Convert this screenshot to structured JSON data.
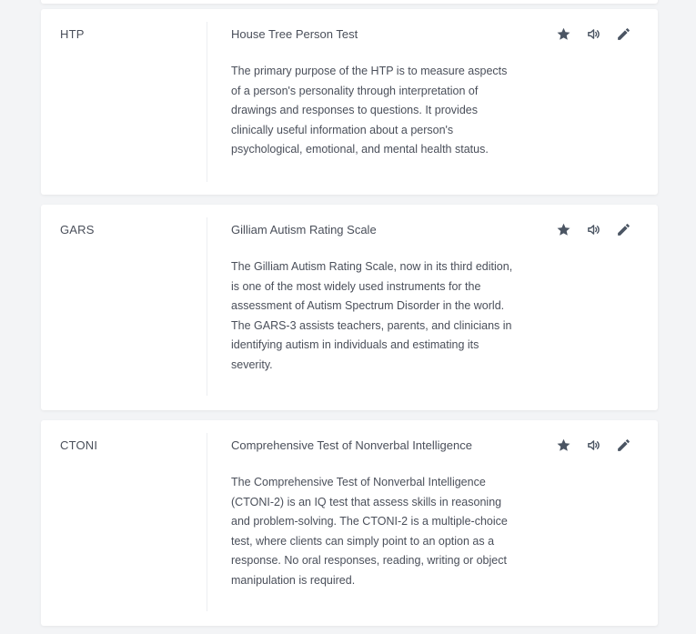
{
  "colors": {
    "background": "#f3f4f6",
    "card": "#ffffff",
    "text": "#4a4f5a",
    "icon": "#4b5563"
  },
  "icons": [
    "star-icon",
    "volume-icon",
    "pencil-icon"
  ],
  "items": [
    {
      "abbreviation": "HTP",
      "title": "House Tree Person Test",
      "description": "The primary purpose of the HTP is to measure aspects of a person's personality through interpretation of drawings and responses to questions. It provides clinically useful information about a person's psychological, emotional, and mental health status."
    },
    {
      "abbreviation": "GARS",
      "title": "Gilliam Autism Rating Scale",
      "description": "The Gilliam Autism Rating Scale, now in its third edition, is one of the most widely used instruments for the assessment of Autism Spectrum Disorder in the world. The GARS-3 assists teachers, parents, and clinicians in identifying autism in individuals and estimating its severity."
    },
    {
      "abbreviation": "CTONI",
      "title": "Comprehensive Test of Nonverbal Intelligence",
      "description": "The Comprehensive Test of Nonverbal Intelligence (CTONI-2) is an IQ test that assess skills in reasoning and problem-solving. The CTONI-2 is a multiple-choice test, where clients can simply point to an option as a response. No oral responses, reading, writing or object manipulation is required."
    }
  ]
}
